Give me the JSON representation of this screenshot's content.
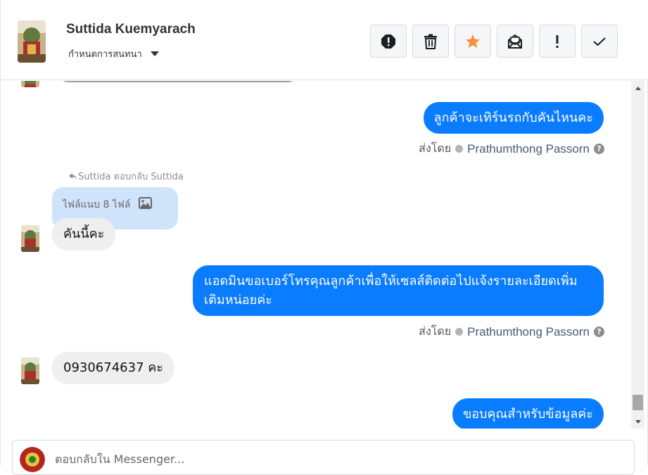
{
  "header": {
    "contact_name": "Suttida Kuemyarach",
    "assign_label": "กำหนดการสนทนา",
    "actions": [
      {
        "name": "spam-button",
        "icon": "alert-circle-icon"
      },
      {
        "name": "delete-button",
        "icon": "trash-icon"
      },
      {
        "name": "star-button",
        "icon": "star-icon",
        "color": "#f7923a"
      },
      {
        "name": "mark-unread-button",
        "icon": "envelope-open-icon"
      },
      {
        "name": "follow-up-button",
        "icon": "exclamation-icon"
      },
      {
        "name": "done-button",
        "icon": "checkmark-icon"
      }
    ]
  },
  "colors": {
    "outgoing_bubble": "#0a7cff",
    "incoming_bubble": "#efefef",
    "attachment_bubble": "#cfe3fb",
    "star": "#f7923a"
  },
  "messages": [
    {
      "direction": "out",
      "text": "ลูกค้าจะเทิร์นรถกับคันไหนคะ",
      "sent_by_label": "ส่งโดย",
      "sender": "Prathumthong Passorn"
    },
    {
      "direction": "in",
      "reply_note": "Suttida ตอบกลับ Suttida",
      "attachment_label": "ไฟล์แนบ 8 ไฟล์",
      "text": "คันนี้คะ"
    },
    {
      "direction": "out",
      "text": "แอดมินขอเบอร์โทรคุณลูกค้าเพื่อให้เซลส์ติดต่อไปแจ้งรายละเอียดเพิ่มเติมหน่อยค่ะ",
      "sent_by_label": "ส่งโดย",
      "sender": "Prathumthong Passorn"
    },
    {
      "direction": "in",
      "text": "0930674637 คะ"
    },
    {
      "direction": "out",
      "text": "ขอบคุณสำหรับข้อมูลค่ะ"
    }
  ],
  "composer": {
    "placeholder": "ตอบกลับใน Messenger..."
  }
}
